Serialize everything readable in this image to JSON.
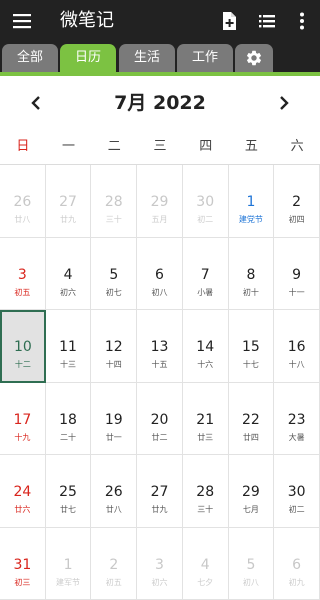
{
  "app": {
    "title": "微笔记"
  },
  "tabs": [
    {
      "label": "全部",
      "active": false
    },
    {
      "label": "日历",
      "active": true
    },
    {
      "label": "生活",
      "active": false
    },
    {
      "label": "工作",
      "active": false
    }
  ],
  "calendar": {
    "month_title": "7月 2022",
    "weekdays": [
      "日",
      "一",
      "二",
      "三",
      "四",
      "五",
      "六"
    ],
    "weeks": [
      [
        {
          "d": "26",
          "l": "廿八",
          "t": "other"
        },
        {
          "d": "27",
          "l": "廿九",
          "t": "other"
        },
        {
          "d": "28",
          "l": "三十",
          "t": "other"
        },
        {
          "d": "29",
          "l": "五月",
          "t": "other"
        },
        {
          "d": "30",
          "l": "初二",
          "t": "other"
        },
        {
          "d": "1",
          "l": "建党节",
          "t": "fest"
        },
        {
          "d": "2",
          "l": "初四",
          "t": ""
        }
      ],
      [
        {
          "d": "3",
          "l": "初五",
          "t": "sun"
        },
        {
          "d": "4",
          "l": "初六",
          "t": ""
        },
        {
          "d": "5",
          "l": "初七",
          "t": ""
        },
        {
          "d": "6",
          "l": "初八",
          "t": ""
        },
        {
          "d": "7",
          "l": "小暑",
          "t": ""
        },
        {
          "d": "8",
          "l": "初十",
          "t": ""
        },
        {
          "d": "9",
          "l": "十一",
          "t": ""
        }
      ],
      [
        {
          "d": "10",
          "l": "十二",
          "t": "sel"
        },
        {
          "d": "11",
          "l": "十三",
          "t": ""
        },
        {
          "d": "12",
          "l": "十四",
          "t": ""
        },
        {
          "d": "13",
          "l": "十五",
          "t": ""
        },
        {
          "d": "14",
          "l": "十六",
          "t": ""
        },
        {
          "d": "15",
          "l": "十七",
          "t": ""
        },
        {
          "d": "16",
          "l": "十八",
          "t": ""
        }
      ],
      [
        {
          "d": "17",
          "l": "十九",
          "t": "sun"
        },
        {
          "d": "18",
          "l": "二十",
          "t": ""
        },
        {
          "d": "19",
          "l": "廿一",
          "t": ""
        },
        {
          "d": "20",
          "l": "廿二",
          "t": ""
        },
        {
          "d": "21",
          "l": "廿三",
          "t": ""
        },
        {
          "d": "22",
          "l": "廿四",
          "t": ""
        },
        {
          "d": "23",
          "l": "大暑",
          "t": ""
        }
      ],
      [
        {
          "d": "24",
          "l": "廿六",
          "t": "sun"
        },
        {
          "d": "25",
          "l": "廿七",
          "t": ""
        },
        {
          "d": "26",
          "l": "廿八",
          "t": ""
        },
        {
          "d": "27",
          "l": "廿九",
          "t": ""
        },
        {
          "d": "28",
          "l": "三十",
          "t": ""
        },
        {
          "d": "29",
          "l": "七月",
          "t": ""
        },
        {
          "d": "30",
          "l": "初二",
          "t": ""
        }
      ],
      [
        {
          "d": "31",
          "l": "初三",
          "t": "sun"
        },
        {
          "d": "1",
          "l": "建军节",
          "t": "other"
        },
        {
          "d": "2",
          "l": "初五",
          "t": "other"
        },
        {
          "d": "3",
          "l": "初六",
          "t": "other"
        },
        {
          "d": "4",
          "l": "七夕",
          "t": "other"
        },
        {
          "d": "5",
          "l": "初八",
          "t": "other"
        },
        {
          "d": "6",
          "l": "初九",
          "t": "other"
        }
      ]
    ]
  },
  "icons": {
    "menu": "hamburger-menu-icon",
    "new_note": "add-note-icon",
    "list": "list-view-icon",
    "more": "more-vert-icon",
    "settings": "gear-icon",
    "prev": "chevron-left-icon",
    "next": "chevron-right-icon"
  },
  "colors": {
    "appbar": "#222222",
    "accent": "#7cc242",
    "tab_inactive": "#7a7a7a",
    "sunday": "#d9251d",
    "festival": "#1e74d6",
    "selected": "#2f6e52"
  }
}
